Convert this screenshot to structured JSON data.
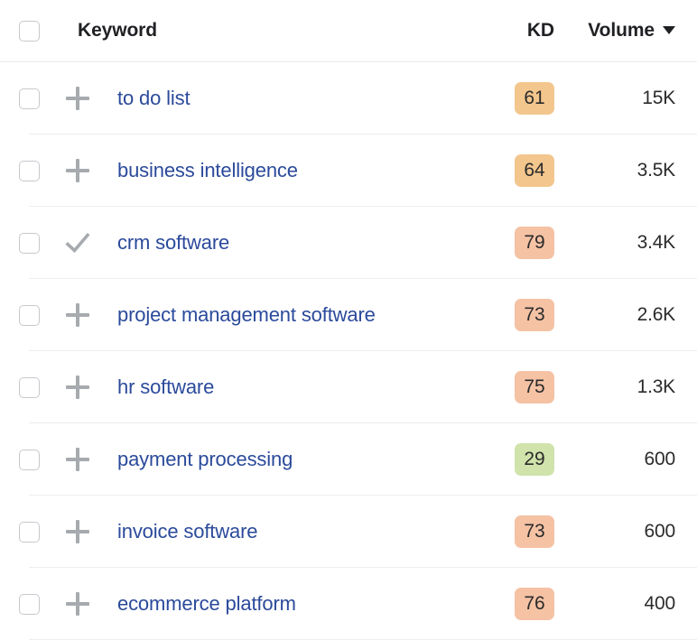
{
  "table": {
    "columns": {
      "keyword_label": "Keyword",
      "kd_label": "KD",
      "volume_label": "Volume",
      "volume_sort_icon": "caret-down-icon"
    },
    "header_checkbox": {
      "name": "select-all-checkbox",
      "checked": false
    },
    "rows": [
      {
        "keyword": "to do list",
        "action_icon": "plus-icon",
        "kd": "61",
        "kd_color": "#f3c68d",
        "volume": "15K",
        "checked": false
      },
      {
        "keyword": "business intelligence",
        "action_icon": "plus-icon",
        "kd": "64",
        "kd_color": "#f3c68d",
        "volume": "3.5K",
        "checked": false
      },
      {
        "keyword": "crm software",
        "action_icon": "check-icon",
        "kd": "79",
        "kd_color": "#f5c2a4",
        "volume": "3.4K",
        "checked": false
      },
      {
        "keyword": "project management software",
        "action_icon": "plus-icon",
        "kd": "73",
        "kd_color": "#f5c2a4",
        "volume": "2.6K",
        "checked": false
      },
      {
        "keyword": "hr software",
        "action_icon": "plus-icon",
        "kd": "75",
        "kd_color": "#f5c2a4",
        "volume": "1.3K",
        "checked": false
      },
      {
        "keyword": "payment processing",
        "action_icon": "plus-icon",
        "kd": "29",
        "kd_color": "#cfe3ab",
        "volume": "600",
        "checked": false
      },
      {
        "keyword": "invoice software",
        "action_icon": "plus-icon",
        "kd": "73",
        "kd_color": "#f5c2a4",
        "volume": "600",
        "checked": false
      },
      {
        "keyword": "ecommerce platform",
        "action_icon": "plus-icon",
        "kd": "76",
        "kd_color": "#f5c2a4",
        "volume": "400",
        "checked": false
      }
    ]
  }
}
